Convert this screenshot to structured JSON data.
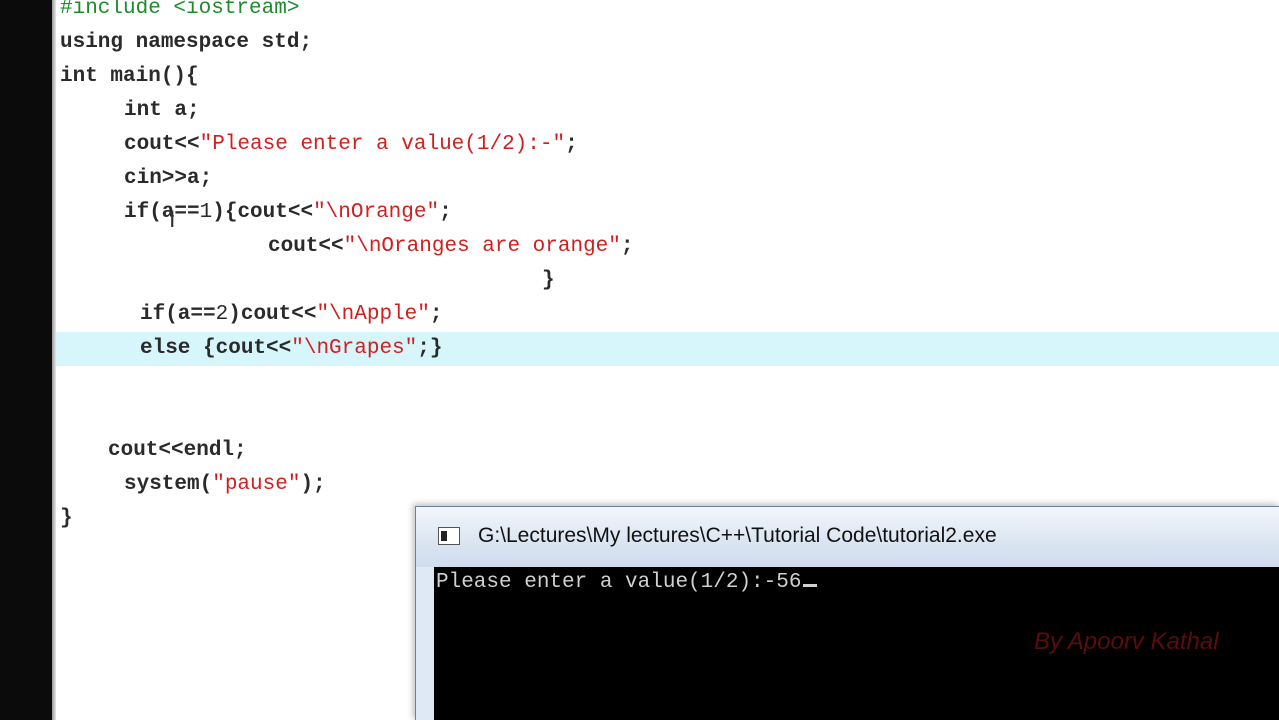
{
  "editor": {
    "lines": [
      {
        "parts": [
          {
            "t": "pp",
            "v": "#include <iostream>"
          }
        ]
      },
      {
        "parts": [
          {
            "t": "code",
            "v": "using namespace std;"
          }
        ]
      },
      {
        "parts": [
          {
            "t": "code",
            "v": "int main(){"
          }
        ]
      },
      {
        "parts": [
          {
            "t": "code",
            "v": "int a;"
          }
        ]
      },
      {
        "parts": [
          {
            "t": "code",
            "v": "cout<<"
          },
          {
            "t": "str",
            "v": "\"Please enter a value(1/2):-\""
          },
          {
            "t": "code",
            "v": ";"
          }
        ]
      },
      {
        "parts": [
          {
            "t": "code",
            "v": "cin>>a;"
          }
        ]
      },
      {
        "parts": [
          {
            "t": "code",
            "v": "if(a=="
          },
          {
            "t": "num",
            "v": "1"
          },
          {
            "t": "code",
            "v": "){cout<<"
          },
          {
            "t": "str",
            "v": "\"\\nOrange\""
          },
          {
            "t": "code",
            "v": ";"
          }
        ]
      },
      {
        "parts": [
          {
            "t": "code",
            "v": "cout<<"
          },
          {
            "t": "str",
            "v": "\"\\nOranges are orange\""
          },
          {
            "t": "code",
            "v": ";"
          }
        ]
      },
      {
        "parts": [
          {
            "t": "code",
            "v": "}"
          }
        ]
      },
      {
        "parts": [
          {
            "t": "code",
            "v": "if(a=="
          },
          {
            "t": "num",
            "v": "2"
          },
          {
            "t": "code",
            "v": ")cout<<"
          },
          {
            "t": "str",
            "v": "\"\\nApple\""
          },
          {
            "t": "code",
            "v": ";"
          }
        ]
      },
      {
        "parts": [
          {
            "t": "code",
            "v": "else {cout<<"
          },
          {
            "t": "str",
            "v": "\"\\nGrapes\""
          },
          {
            "t": "code",
            "v": ";}"
          }
        ]
      },
      {
        "parts": [
          {
            "t": "code",
            "v": "cout<<endl;"
          }
        ]
      },
      {
        "parts": [
          {
            "t": "code",
            "v": "system("
          },
          {
            "t": "str",
            "v": "\"pause\""
          },
          {
            "t": "code",
            "v": ");"
          }
        ]
      },
      {
        "parts": [
          {
            "t": "code",
            "v": "}"
          }
        ]
      }
    ]
  },
  "console": {
    "title": "G:\\Lectures\\My lectures\\C++\\Tutorial Code\\tutorial2.exe",
    "output_line": "Please enter a value(1/2):-56",
    "watermark": "By Apoorv Kathal"
  },
  "colors": {
    "string": "#d11f1f",
    "preprocessor": "#1f8a2e",
    "current_line_highlight": "#d6f6fb",
    "console_background": "#000000"
  }
}
